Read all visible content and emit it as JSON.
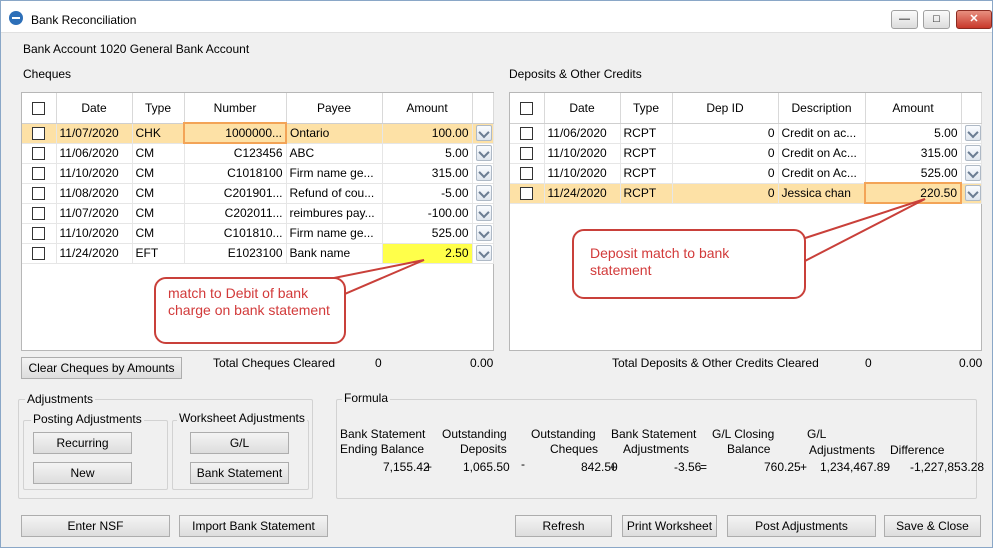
{
  "window": {
    "title": "Bank Reconciliation",
    "account_label": "Bank Account 1020 General Bank Account"
  },
  "cheques": {
    "section_label": "Cheques",
    "columns": [
      "Date",
      "Type",
      "Number",
      "Payee",
      "Amount"
    ],
    "rows": [
      {
        "date": "11/07/2020",
        "type": "CHK",
        "number": "1000000...",
        "payee": "Ontario",
        "amount": "100.00",
        "selected": true
      },
      {
        "date": "11/06/2020",
        "type": "CM",
        "number": "C123456",
        "payee": "ABC",
        "amount": "5.00"
      },
      {
        "date": "11/10/2020",
        "type": "CM",
        "number": "C1018100",
        "payee": "Firm name ge...",
        "amount": "315.00"
      },
      {
        "date": "11/08/2020",
        "type": "CM",
        "number": "C201901...",
        "payee": "Refund of cou...",
        "amount": "-5.00"
      },
      {
        "date": "11/07/2020",
        "type": "CM",
        "number": "C202011...",
        "payee": "reimbures pay...",
        "amount": "-100.00"
      },
      {
        "date": "11/10/2020",
        "type": "CM",
        "number": "C101810...",
        "payee": "Firm name ge...",
        "amount": "525.00"
      },
      {
        "date": "11/24/2020",
        "type": "EFT",
        "number": "E1023100",
        "payee": "Bank name",
        "amount": "2.50",
        "highlight_amount": true
      }
    ],
    "total_label": "Total Cheques Cleared",
    "total_count": "0",
    "total_amount": "0.00",
    "clear_button": "Clear Cheques by Amounts"
  },
  "deposits": {
    "section_label": "Deposits & Other Credits",
    "columns": [
      "Date",
      "Type",
      "Dep ID",
      "Description",
      "Amount"
    ],
    "rows": [
      {
        "date": "11/06/2020",
        "type": "RCPT",
        "dep_id": "0",
        "description": "Credit on ac...",
        "amount": "5.00"
      },
      {
        "date": "11/10/2020",
        "type": "RCPT",
        "dep_id": "0",
        "description": "Credit on Ac...",
        "amount": "315.00"
      },
      {
        "date": "11/10/2020",
        "type": "RCPT",
        "dep_id": "0",
        "description": "Credit on Ac...",
        "amount": "525.00"
      },
      {
        "date": "11/24/2020",
        "type": "RCPT",
        "dep_id": "0",
        "description": "Jessica chan",
        "amount": "220.50",
        "selected": true
      }
    ],
    "total_label": "Total Deposits & Other Credits Cleared",
    "total_count": "0",
    "total_amount": "0.00"
  },
  "callouts": {
    "cheque_note": "match to Debit of bank charge on bank statement",
    "deposit_note": "Deposit match to bank statement"
  },
  "adjustments": {
    "group_label": "Adjustments",
    "posting_label": "Posting Adjustments",
    "worksheet_label": "Worksheet Adjustments",
    "recurring": "Recurring",
    "new": "New",
    "gl": "G/L",
    "bank_statement": "Bank Statement"
  },
  "formula": {
    "group_label": "Formula",
    "items": [
      {
        "label1": "Bank Statement",
        "label2": "Ending Balance",
        "value": "7,155.42",
        "op": "+"
      },
      {
        "label1": "Outstanding",
        "label2": "Deposits",
        "value": "1,065.50",
        "op": "-"
      },
      {
        "label1": "Outstanding",
        "label2": "Cheques",
        "value": "842.50",
        "op": "+"
      },
      {
        "label1": "Bank Statement",
        "label2": "Adjustments",
        "value": "-3.56",
        "op": "="
      },
      {
        "label1": "G/L Closing",
        "label2": "Balance",
        "value": "760.25",
        "op": "+"
      },
      {
        "label1": "G/L",
        "label2": "Adjustments",
        "value": "1,234,467.89",
        "op": ""
      },
      {
        "label1": "",
        "label2": "Difference",
        "value": "-1,227,853.28",
        "op": ""
      }
    ]
  },
  "buttons": {
    "enter_nsf": "Enter NSF",
    "import_bank_statement": "Import Bank Statement",
    "refresh": "Refresh",
    "print_worksheet": "Print Worksheet",
    "post_adjustments": "Post Adjustments",
    "save_close": "Save & Close"
  }
}
